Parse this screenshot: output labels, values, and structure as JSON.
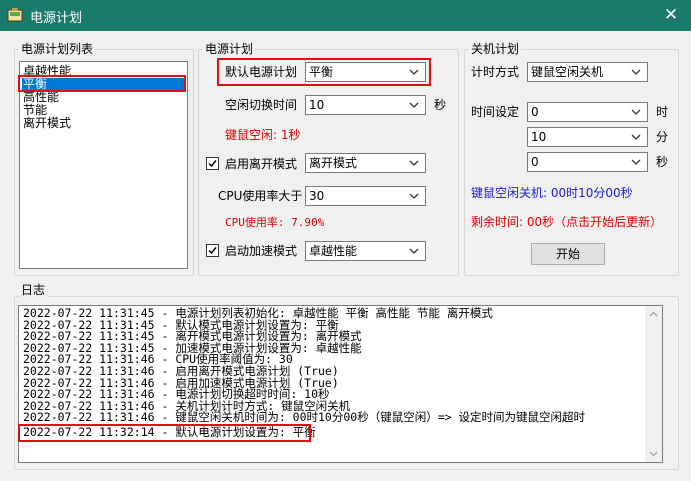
{
  "window": {
    "title": "电源计划",
    "close_label": "✕"
  },
  "plan_list": {
    "label": "电源计划列表",
    "items": [
      "卓越性能",
      "平衡",
      "高性能",
      "节能",
      "离开模式"
    ],
    "selected_index": 1
  },
  "power_plan": {
    "label": "电源计划",
    "default_plan_label": "默认电源计划",
    "default_plan_value": "平衡",
    "idle_switch_label": "空闲切换时间",
    "idle_switch_value": "10",
    "idle_switch_unit": "秒",
    "idle_status": "键鼠空闲: 1秒",
    "away_mode_label": "启用离开模式",
    "away_mode_checked": true,
    "away_mode_value": "离开模式",
    "cpu_threshold_label": "CPU使用率大于",
    "cpu_threshold_value": "30",
    "cpu_usage_status": "CPU使用率: 7.90%",
    "boost_mode_label": "启动加速模式",
    "boost_mode_checked": true,
    "boost_mode_value": "卓越性能"
  },
  "shutdown_plan": {
    "label": "关机计划",
    "timer_mode_label": "计时方式",
    "timer_mode_value": "键鼠空闲关机",
    "time_setting_label": "时间设定",
    "hours_value": "0",
    "hours_unit": "时",
    "minutes_value": "10",
    "minutes_unit": "分",
    "seconds_value": "0",
    "seconds_unit": "秒",
    "shutdown_status": "键鼠空闲关机: 00时10分00秒",
    "remaining_status": "剩余时间: 00秒（点击开始后更新）",
    "start_button": "开始"
  },
  "log": {
    "label": "日志",
    "lines": [
      "2022-07-22 11:31:45 - 电源计划列表初始化: 卓越性能 平衡 高性能 节能 离开模式",
      "2022-07-22 11:31:45 - 默认模式电源计划设置为: 平衡",
      "2022-07-22 11:31:45 - 离开模式电源计划设置为: 离开模式",
      "2022-07-22 11:31:45 - 加速模式电源计划设置为: 卓越性能",
      "2022-07-22 11:31:46 - CPU使用率阈值为: 30",
      "2022-07-22 11:31:46 - 启用离开模式电源计划 (True)",
      "2022-07-22 11:31:46 - 启用加速模式电源计划 (True)",
      "2022-07-22 11:31:46 - 电源计划切换超时时间: 10秒",
      "2022-07-22 11:31:46 - 关机计划计时方式: 键鼠空闲关机",
      "2022-07-22 11:31:46 - 键鼠空闲关机时间为: 00时10分00秒（键鼠空闲）=> 设定时间为键鼠空闲超时",
      "2022-07-22 11:32:14 - 默认电源计划设置为: 平衡"
    ]
  },
  "colors": {
    "titlebar": "#1a7a6c",
    "highlight": "#e01010",
    "selection": "#0078d7",
    "status_red": "#e00000",
    "status_blue": "#1a1ad6"
  },
  "icons": {
    "app": "power-plan-app-icon",
    "close": "close-icon",
    "dropdown": "chevron-down-icon",
    "check": "checkmark-icon"
  }
}
